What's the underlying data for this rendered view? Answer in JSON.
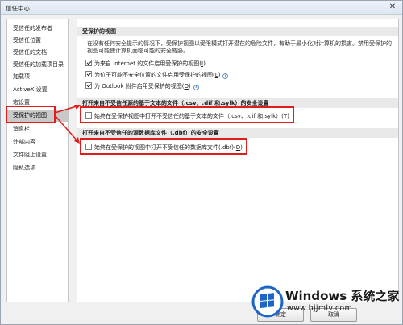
{
  "window": {
    "title": "信任中心",
    "close": "✕"
  },
  "sidebar": {
    "items": [
      {
        "label": "受信任的发布者"
      },
      {
        "label": "受信任位置"
      },
      {
        "label": "受信任的文档"
      },
      {
        "label": "受信任的加载项目录"
      },
      {
        "label": "加载项"
      },
      {
        "label": "ActiveX 设置"
      },
      {
        "label": "宏设置"
      },
      {
        "label": "受保护的视图"
      },
      {
        "label": "消息栏"
      },
      {
        "label": "外部内容"
      },
      {
        "label": "文件阻止设置"
      },
      {
        "label": "隐私选项"
      }
    ],
    "active_index": 7
  },
  "protected_view": {
    "header": "受保护的视图",
    "description": "在没有任何安全提示的情况下，受保护视图以受限模式打开潜在的危险文件，有助于最小化对计算机的损害。禁用受保护的视图可能使计算机面临可能的安全威胁。",
    "options": [
      {
        "text": "为来自 Internet 的文件启用受保护的视图(",
        "key": "I",
        "end": ")",
        "checked": true,
        "info": false
      },
      {
        "text": "为位于可能不安全位置的文件启用受保护的视图(",
        "key": "L",
        "end": ")",
        "checked": true,
        "info": true
      },
      {
        "text": "为 Outlook 附件启用受保护的视图(",
        "key": "O",
        "end": ")",
        "checked": true,
        "info": true
      }
    ]
  },
  "text_files": {
    "header": "打开来自不受信任源的基于文本的文件（.csv、.dif 和.sylk）的安全设置",
    "option": {
      "text": "始终在受保护视图中打开不受信任的基于文本的文件（.csv、.dif 和.sylk）(",
      "key": "T",
      "end": ")",
      "checked": false,
      "info": true
    }
  },
  "database_files": {
    "header": "打开来自不受信任的源数据库文件（.dbf）的安全设置",
    "option": {
      "text": "始终在受保护的视图中打开不受信任的数据库文件(.dbf)(",
      "key": "D",
      "end": ")",
      "checked": false,
      "info": false
    }
  },
  "buttons": {
    "ok": "确定",
    "cancel": "取消"
  },
  "watermark": {
    "brand": "Windows 系统之家",
    "url": "www.bjjmlv.com"
  },
  "colors": {
    "highlight": "#e21b1b",
    "active_nav": "#c9c9c9",
    "section_header": "#e9e9e9"
  }
}
